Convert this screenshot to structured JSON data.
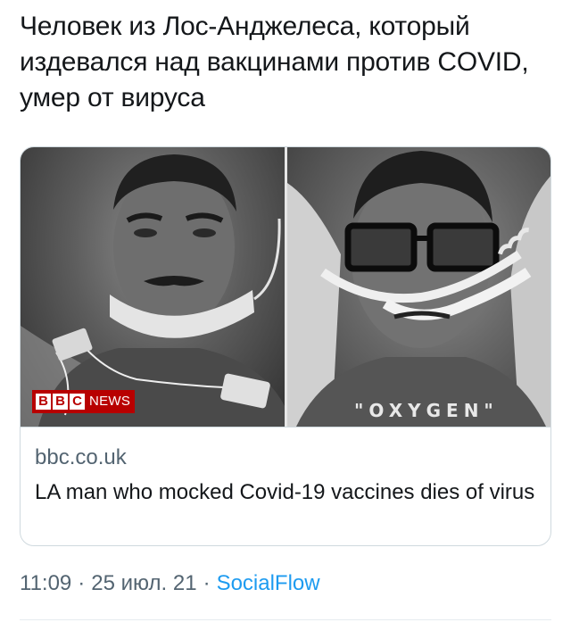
{
  "tweet": {
    "text": "Человек из Лос-Анджелеса, который издевался над вакцинами против COVID, умер от вируса"
  },
  "card": {
    "image_left_logo": {
      "letters": [
        "B",
        "B",
        "C"
      ],
      "word": "NEWS"
    },
    "image_right_caption": "\"OXYGEN\"",
    "domain": "bbc.co.uk",
    "title": "LA man who mocked Covid-19 vaccines dies of virus"
  },
  "meta": {
    "time": "11:09",
    "separator": "·",
    "date": "25 июл. 21",
    "source": "SocialFlow"
  },
  "colors": {
    "link": "#1d9bf0",
    "secondary_text": "#536471",
    "bbc_red": "#b80000"
  }
}
